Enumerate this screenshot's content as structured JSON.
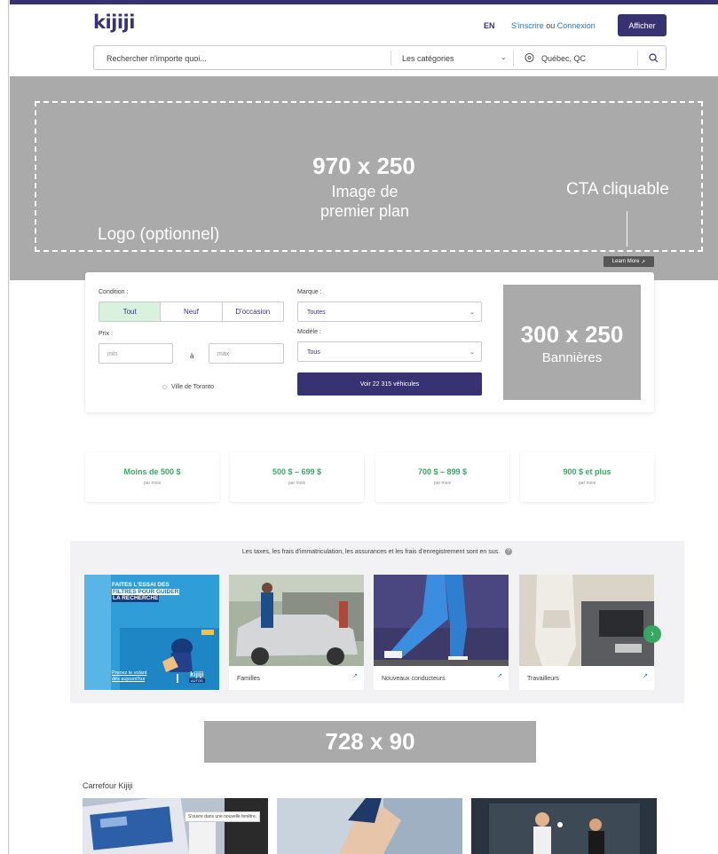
{
  "header": {
    "logo": "kijiji",
    "lang": "EN",
    "signup": "S'inscrire",
    "or": " ou ",
    "login": "Connexion",
    "post_button": "Afficher"
  },
  "search": {
    "placeholder": "Rechercher n'importe quoi...",
    "category": "Les catégories",
    "location": "Québec, QC"
  },
  "hero": {
    "size": "970 x 250",
    "subtitle_line1": "Image de",
    "subtitle_line2": "premier plan",
    "logo_label": "Logo (optionnel)",
    "cta_label": "CTA cliquable",
    "learn_more": "Learn More"
  },
  "filter": {
    "condition_label": "Condition :",
    "conditions": [
      "Tout",
      "Neuf",
      "D'occasion"
    ],
    "price_label": "Prix :",
    "min_placeholder": "min",
    "max_placeholder": "max",
    "price_separator": "à",
    "make_label": "Marque :",
    "make_value": "Toutes",
    "model_label": "Modèle :",
    "model_value": "Tous",
    "city": "Ville de Toronto",
    "submit": "Voir 22 315 véhicules"
  },
  "side_banner": {
    "size": "300 x 250",
    "label": "Bannières"
  },
  "price_ranges": [
    {
      "label": "Moins de 500 $",
      "sub": "par mois"
    },
    {
      "label": "500 $ – 699 $",
      "sub": "par mois"
    },
    {
      "label": "700 $ – 899 $",
      "sub": "par mois"
    },
    {
      "label": "900 $ et plus",
      "sub": "par mois"
    }
  ],
  "promo": {
    "tax_note": "Les taxes, les frais d'immatriculation, les assurances et les frais d'enregistrement sont en sus.",
    "help_icon": "?",
    "feature": {
      "headline1": "FAITES L'ESSAI DES",
      "headline2": "FILTRES POUR GUIDER",
      "headline3": "LA RECHERCHE",
      "cta1": "Prenez le volant",
      "cta2": "dès aujourd'hui",
      "brand": "kijiji",
      "brand_sub": "AUTOS"
    },
    "cards": [
      {
        "title": "Familles"
      },
      {
        "title": "Nouveaux conducteurs"
      },
      {
        "title": "Travailleurs"
      }
    ],
    "next_icon": "›"
  },
  "leaderboard": {
    "size": "728 x 90"
  },
  "carrefour": {
    "title": "Carrefour Kijiji",
    "tooltip": "S'ouvre dans une nouvelle fenêtre."
  },
  "colors": {
    "brand": "#373373",
    "accent_green": "#37a864",
    "link_blue": "#2675c5",
    "placeholder_gray": "#aaaaaa"
  }
}
